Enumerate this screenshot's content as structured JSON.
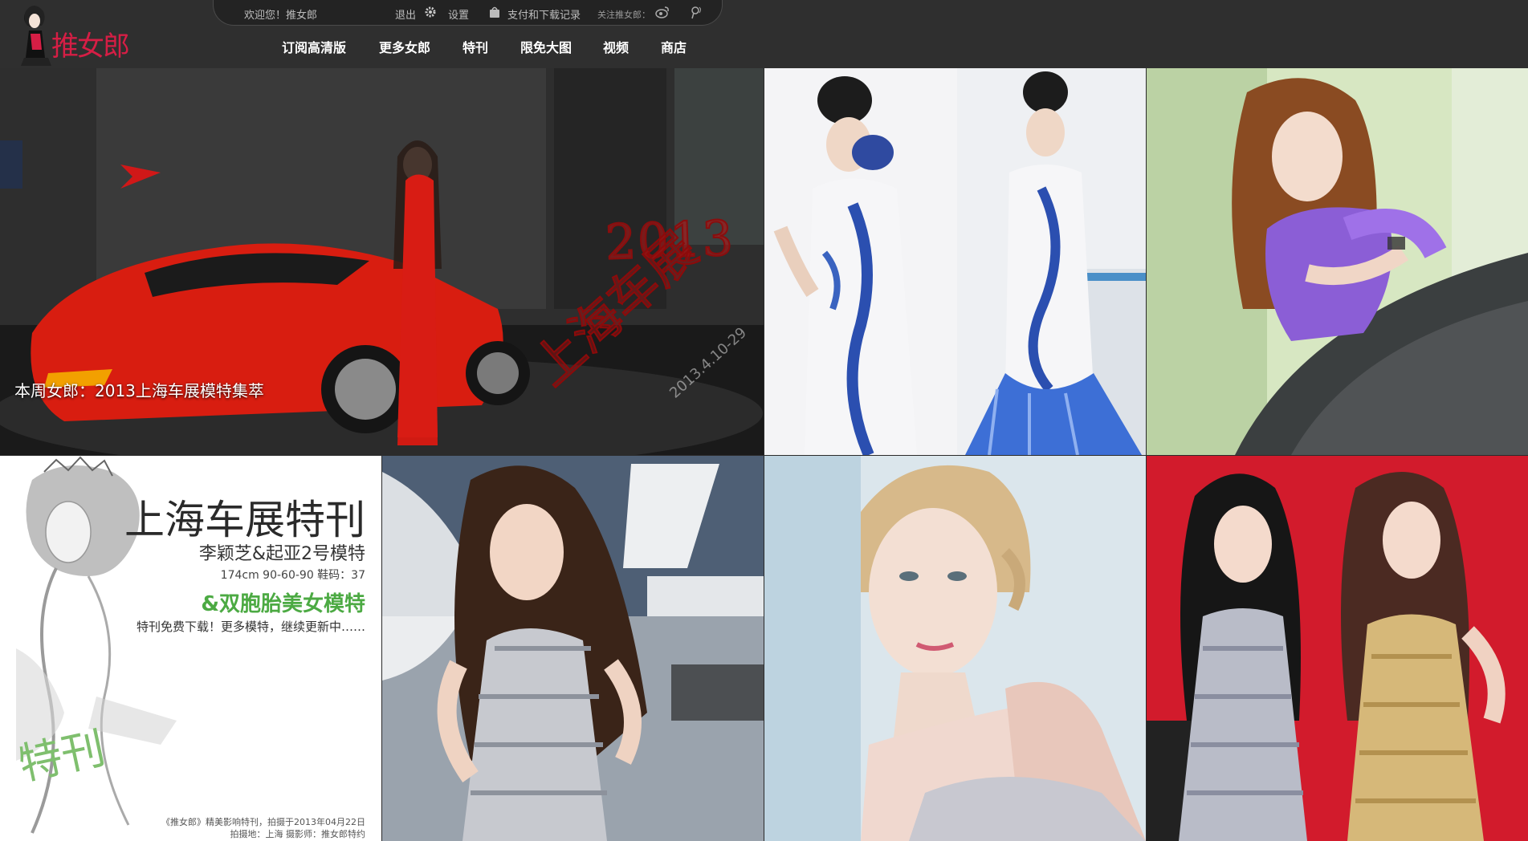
{
  "header": {
    "logo_text": "推女郎",
    "topbar": {
      "welcome": "欢迎您！推女郎",
      "logout": "退出",
      "settings": "设置",
      "records": "支付和下载记录",
      "follow": "关注推女郎："
    },
    "nav": [
      "订阅高清版",
      "更多女郎",
      "特刊",
      "限免大图",
      "视频",
      "商店"
    ]
  },
  "tiles": {
    "feature": {
      "caption": "本周女郎：2013上海车展模特集萃",
      "stamp_year": "2013",
      "stamp_title": "上海车展",
      "stamp_date": "2013.4.10-29"
    },
    "special_issue": {
      "title": "上海车展特刊",
      "model": "李颖芝&起亚2号模特",
      "stats": "174cm 90-60-90 鞋码：37",
      "twins": "&双胞胎美女模特",
      "note": "特刊免费下载！更多模特，继续更新中……",
      "tekan": "特刊",
      "footer_line1": "《推女郎》精美影响特刊，拍摄于2013年04月22日",
      "footer_line2": "拍摄地：上海 摄影师：推女郎特约"
    }
  },
  "colors": {
    "header_bg": "#2f2f2f",
    "logo_red": "#d61e45",
    "special_green": "#4caa43"
  }
}
